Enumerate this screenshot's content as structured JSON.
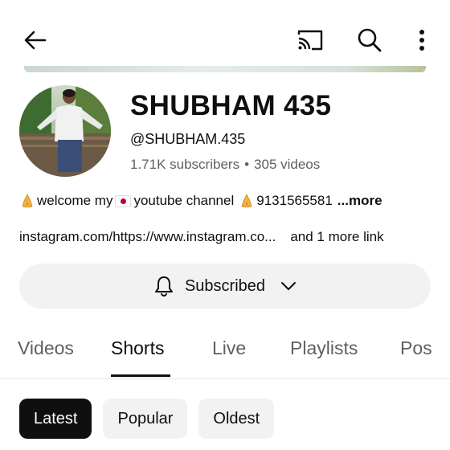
{
  "topbar": {
    "back_icon": "arrow-left-icon",
    "cast_icon": "cast-icon",
    "search_icon": "search-icon",
    "more_icon": "more-vertical-icon"
  },
  "channel": {
    "name": "SHUBHAM 435",
    "handle": "@SHUBHAM.435",
    "subscribers": "1.71K subscribers",
    "separator": "•",
    "videos": "305 videos",
    "description": "welcome my",
    "description_2": "youtube channel",
    "phone": "9131565581",
    "more_label": "...more",
    "link_url": "instagram.com/https://www.instagram.co...",
    "link_more": "and 1 more link"
  },
  "subscribe_button": {
    "label": "Subscribed",
    "bell_icon": "bell-icon",
    "chevron_icon": "chevron-down-icon"
  },
  "tabs": [
    {
      "label": "Videos"
    },
    {
      "label": "Shorts",
      "active": true
    },
    {
      "label": "Live"
    },
    {
      "label": "Playlists"
    },
    {
      "label": "Pos"
    }
  ],
  "chips": [
    {
      "label": "Latest",
      "selected": true
    },
    {
      "label": "Popular"
    },
    {
      "label": "Oldest"
    }
  ],
  "colors": {
    "text": "#0f0f0f",
    "secondary_text": "#606060",
    "chip_bg": "#f2f2f2",
    "selected_chip_bg": "#0f0f0f"
  }
}
